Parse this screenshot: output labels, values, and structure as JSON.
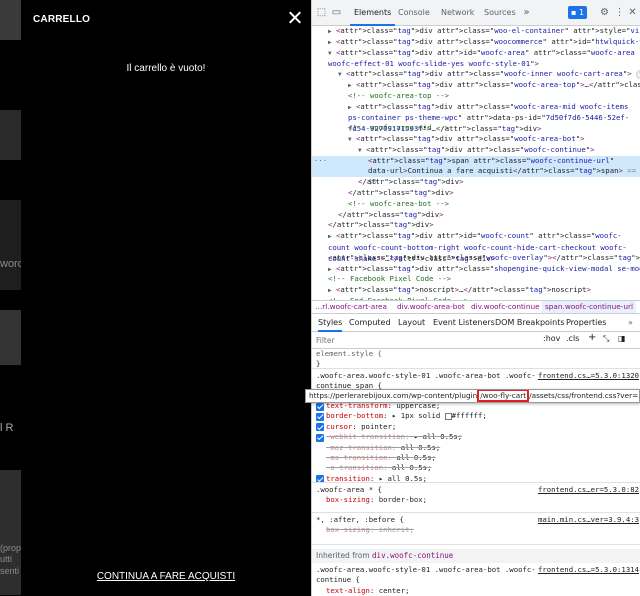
{
  "cart": {
    "title": "CARRELLO",
    "empty_message": "Il carrello è vuoto!",
    "continue_label": "CONTINUA A FARE ACQUISTI"
  },
  "background_fragments": [
    "word",
    "l  R",
    "(prop",
    "utti",
    "senti"
  ],
  "devtools": {
    "tabs": [
      "Elements",
      "Console",
      "Network",
      "Sources"
    ],
    "active_tab": "Elements",
    "message_count": "1",
    "dom_lines": [
      {
        "t": "▶ <div class=\"woo-el-container\" style=\"visibility: hidden;\">…</div>"
      },
      {
        "t": "▶ <div class=\"woocommerce\" id=\"htwlquick-viewmodal\">…</div>",
        "b": "flex"
      },
      {
        "t": "▼ <div id=\"woofc-area\" class=\"woofc-area woofc-effect-01 woofc-slide-yes woofc-style-01\">"
      },
      {
        "t": "▼ <div class=\"woofc-inner woofc-cart-area\">",
        "b": "flex"
      },
      {
        "t": "▶ <div class=\"woofc-area-top\">…</div>"
      },
      {
        "t": "<!-- woofc-area-top -->"
      },
      {
        "t": "▶ <div class=\"woofc-area-mid woofc-items ps-container ps-theme-wpc\" data-ps-id=\"7d50f7d6-5446-52ef-fd54-92709171593f\">…</div>"
      },
      {
        "t": "<!-- woofc-area-mid -->"
      },
      {
        "t": "▼ <div class=\"woofc-area-bot\">"
      },
      {
        "t": "▼ <div class=\"woofc-continue\">"
      },
      {
        "t": "<span class=\"woofc-continue-url\" data-url>Continua a fare acquisti</span> == $0"
      },
      {
        "t": "</div>"
      },
      {
        "t": "</div>"
      },
      {
        "t": "<!-- woofc-area-bot -->"
      },
      {
        "t": "</div>"
      },
      {
        "t": "</div>"
      },
      {
        "t": "▶ <div id=\"woofc-count\" class=\"woofc-count woofc-count-bottom-right woofc-count-hide-cart-checkout woofc-count-shake\">…</div>"
      },
      {
        "t": "<div class=\"woofc-overlay\"></div>"
      },
      {
        "t": "▶ <div class=\"shopengine-quick-view-modal se-modal-wrapper\">…</div>"
      },
      {
        "t": "<!-- Facebook Pixel Code -->"
      },
      {
        "t": "▶ <noscript>…</noscript>"
      },
      {
        "t": "<!-- End Facebook Pixel Code -->"
      }
    ],
    "breadcrumbs": [
      "…rl.woofc-cart-area",
      "div.woofc-area-bot",
      "div.woofc-continue",
      "span.woofc-continue-url"
    ],
    "style_tabs": [
      "Styles",
      "Computed",
      "Layout",
      "Event Listeners",
      "DOM Breakpoints",
      "Properties"
    ],
    "filter_placeholder": "Filter",
    "filter_hov": ":hov",
    "filter_cls": ".cls",
    "element_style": "element.style {",
    "element_style_close": "}",
    "rule1_selector": ".woofc-area.woofc-style-01 .woofc-area-bot .woofc-continue span {",
    "rule1_source": "frontend.cs…=5.3.0:1320",
    "tooltip_before": "https://perlerarebijoux.com/wp-content/plugin",
    "tooltip_highlight": "/woo-fly-cart",
    "tooltip_after": "/assets/css/frontend.css?ver=5.3.0:1320",
    "rule1_props": [
      {
        "n": "text-transform",
        "v": "uppercase;",
        "s": false
      },
      {
        "n": "border-bottom",
        "v": "▸ 1px solid ",
        "s": false,
        "swatch": "#ffffff",
        "sv": "#ffffff;"
      },
      {
        "n": "cursor",
        "v": "pointer;",
        "s": false
      },
      {
        "n": "-webkit-transition",
        "v": "▸ all 0.5s;",
        "s": true
      },
      {
        "n": "-moz-transition",
        "v": "all 0.5s;",
        "s": true
      },
      {
        "n": "-ms-transition",
        "v": "all 0.5s;",
        "s": true
      },
      {
        "n": "-o-transition",
        "v": "all 0.5s;",
        "s": true
      },
      {
        "n": "transition",
        "v": "▸ all 0.5s;",
        "s": false
      }
    ],
    "rule2_selector": ".woofc-area * {",
    "rule2_source": "frontend.cs…er=5.3.0:82",
    "rule2_prop": {
      "n": "box-sizing",
      "v": "border-box;"
    },
    "rule3_selector": "*, :after, :before {",
    "rule3_source": "main.min.cs…ver=3.9.4:3",
    "rule3_prop": {
      "n": "box-sizing",
      "v": "inherit;"
    },
    "inherited_label": "Inherited from",
    "inherited_from": "div.woofc-continue",
    "rule4_selector": ".woofc-area.woofc-style-01 .woofc-area-bot .woofc-continue {",
    "rule4_source": "frontend.cs…=5.3.0:1314",
    "rule4_prop": {
      "n": "text-align",
      "v": "center;"
    }
  },
  "colors": {
    "accent": "#1a73e8",
    "tag": "#881280",
    "attr": "#994500",
    "value": "#1a1aa6",
    "comment": "#236e25",
    "highlight_box": "#e0201b"
  }
}
